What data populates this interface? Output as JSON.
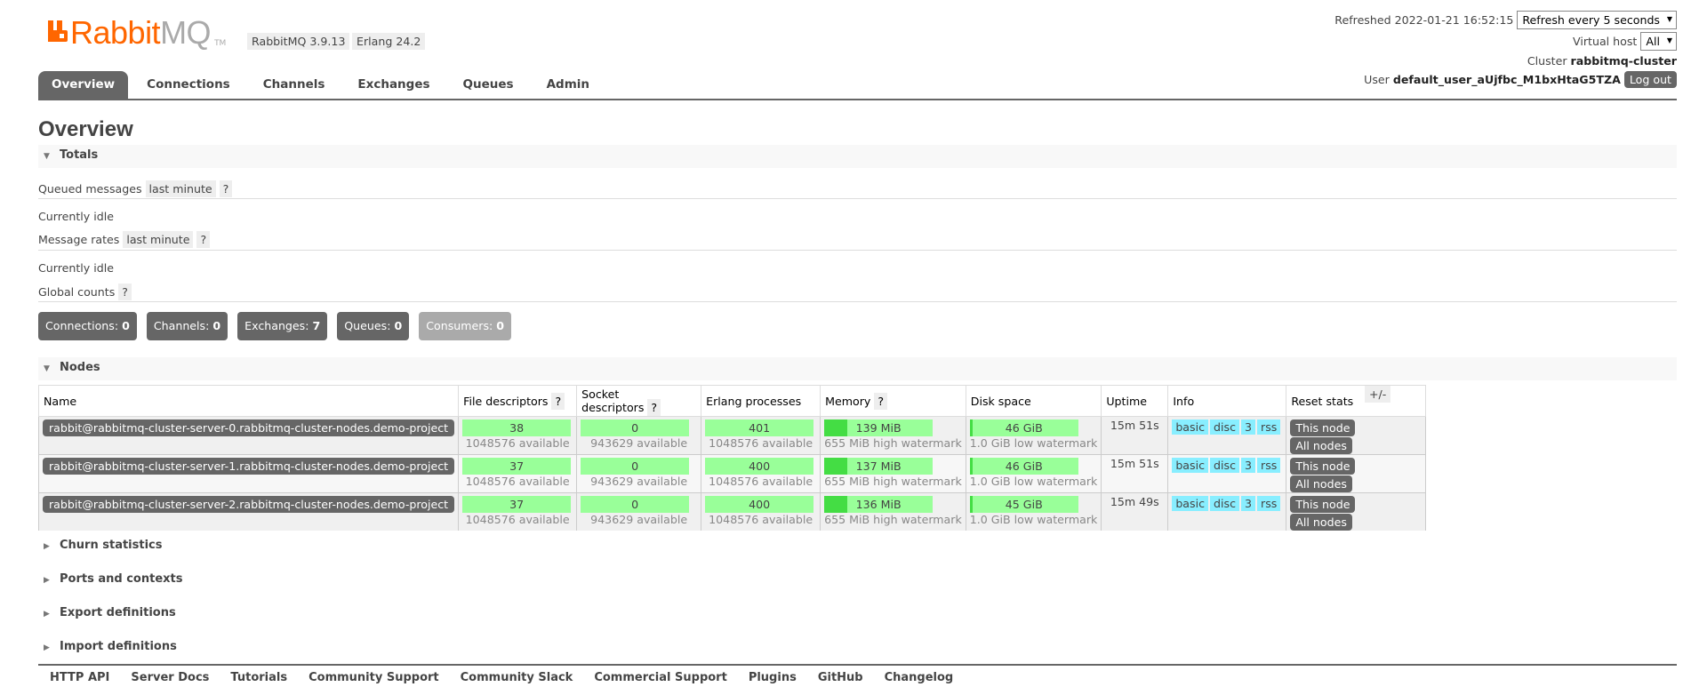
{
  "header": {
    "logo_main": "Rabbit",
    "logo_suffix": "MQ",
    "logo_tm": "TM",
    "version_rabbitmq": "RabbitMQ 3.9.13",
    "version_erlang": "Erlang 24.2",
    "refreshed_label": "Refreshed 2022-01-21 16:52:15",
    "refresh_select": "Refresh every 5 seconds",
    "vhost_label": "Virtual host",
    "vhost_select": "All",
    "cluster_label": "Cluster",
    "cluster_name": "rabbitmq-cluster",
    "user_label": "User",
    "user_name": "default_user_aUjfbc_M1bxHtaG5TZA",
    "logout_label": "Log out"
  },
  "tabs": [
    {
      "label": "Overview",
      "active": true
    },
    {
      "label": "Connections"
    },
    {
      "label": "Channels"
    },
    {
      "label": "Exchanges"
    },
    {
      "label": "Queues"
    },
    {
      "label": "Admin"
    }
  ],
  "main": {
    "title": "Overview",
    "totals": {
      "heading": "Totals",
      "queued_label": "Queued messages",
      "queued_range": "last minute",
      "help": "?",
      "idle_1": "Currently idle",
      "rates_label": "Message rates",
      "rates_range": "last minute",
      "idle_2": "Currently idle",
      "global_label": "Global counts"
    },
    "counts": [
      {
        "label": "Connections:",
        "value": "0"
      },
      {
        "label": "Channels:",
        "value": "0"
      },
      {
        "label": "Exchanges:",
        "value": "7"
      },
      {
        "label": "Queues:",
        "value": "0"
      },
      {
        "label": "Consumers:",
        "value": "0"
      }
    ],
    "nodes": {
      "heading": "Nodes",
      "plus_minus": "+/-",
      "columns": [
        "Name",
        "File descriptors",
        "Socket descriptors",
        "Erlang processes",
        "Memory",
        "Disk space",
        "Uptime",
        "Info",
        "Reset stats"
      ],
      "rows": [
        {
          "name": "rabbit@rabbitmq-cluster-server-0.rabbitmq-cluster-nodes.demo-project",
          "fd": "38",
          "fd_avail": "1048576 available",
          "sd": "0",
          "sd_avail": "943629 available",
          "ep": "401",
          "ep_avail": "1048576 available",
          "mem": "139 MiB",
          "mem_sub": "655 MiB high watermark",
          "mem_frac": 0.21,
          "disk": "46 GiB",
          "disk_sub": "1.0 GiB low watermark",
          "uptime": "15m 51s",
          "info": [
            "basic",
            "disc",
            "3",
            "rss"
          ],
          "reset_this": "This node",
          "reset_all": "All nodes"
        },
        {
          "name": "rabbit@rabbitmq-cluster-server-1.rabbitmq-cluster-nodes.demo-project",
          "fd": "37",
          "fd_avail": "1048576 available",
          "sd": "0",
          "sd_avail": "943629 available",
          "ep": "400",
          "ep_avail": "1048576 available",
          "mem": "137 MiB",
          "mem_sub": "655 MiB high watermark",
          "mem_frac": 0.21,
          "disk": "46 GiB",
          "disk_sub": "1.0 GiB low watermark",
          "uptime": "15m 51s",
          "info": [
            "basic",
            "disc",
            "3",
            "rss"
          ],
          "reset_this": "This node",
          "reset_all": "All nodes"
        },
        {
          "name": "rabbit@rabbitmq-cluster-server-2.rabbitmq-cluster-nodes.demo-project",
          "fd": "37",
          "fd_avail": "1048576 available",
          "sd": "0",
          "sd_avail": "943629 available",
          "ep": "400",
          "ep_avail": "1048576 available",
          "mem": "136 MiB",
          "mem_sub": "655 MiB high watermark",
          "mem_frac": 0.21,
          "disk": "45 GiB",
          "disk_sub": "1.0 GiB low watermark",
          "uptime": "15m 49s",
          "info": [
            "basic",
            "disc",
            "3",
            "rss"
          ],
          "reset_this": "This node",
          "reset_all": "All nodes"
        }
      ]
    },
    "collapsed_sections": [
      "Churn statistics",
      "Ports and contexts",
      "Export definitions",
      "Import definitions"
    ]
  },
  "footer": [
    "HTTP API",
    "Server Docs",
    "Tutorials",
    "Community Support",
    "Community Slack",
    "Commercial Support",
    "Plugins",
    "GitHub",
    "Changelog"
  ]
}
